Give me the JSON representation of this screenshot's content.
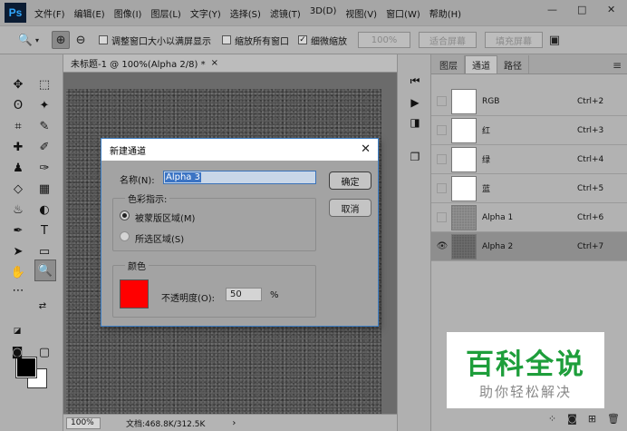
{
  "app": {
    "logo": "Ps"
  },
  "menu": [
    "文件(F)",
    "编辑(E)",
    "图像(I)",
    "图层(L)",
    "文字(Y)",
    "选择(S)",
    "滤镜(T)",
    "3D(D)",
    "视图(V)",
    "窗口(W)",
    "帮助(H)"
  ],
  "window_controls": {
    "minimize": "—",
    "maximize": "□",
    "close": "✕"
  },
  "options": {
    "resize_windows_label": "调整窗口大小以满屏显示",
    "zoom_all_label": "缩放所有窗口",
    "scrubby_zoom_label": "细微缩放",
    "percent_btn": "100%",
    "fit_screen_btn": "适合屏幕",
    "fill_screen_btn": "填充屏幕"
  },
  "document": {
    "tab_title": "未标题-1 @ 100%(Alpha 2/8) *",
    "tab_close": "×",
    "zoom": "100%",
    "doc_info": "文档:468.8K/312.5K"
  },
  "panel": {
    "tabs": [
      "图层",
      "通道",
      "路径"
    ],
    "active_tab": "通道",
    "channels": [
      {
        "name": "RGB",
        "shortcut": "Ctrl+2"
      },
      {
        "name": "红",
        "shortcut": "Ctrl+3"
      },
      {
        "name": "绿",
        "shortcut": "Ctrl+4"
      },
      {
        "name": "蓝",
        "shortcut": "Ctrl+5"
      },
      {
        "name": "Alpha 1",
        "shortcut": "Ctrl+6"
      },
      {
        "name": "Alpha 2",
        "shortcut": "Ctrl+7"
      }
    ]
  },
  "dialog": {
    "title": "新建通道",
    "close": "✕",
    "name_label": "名称(N):",
    "name_value": "Alpha 3",
    "ok_button": "确定",
    "cancel_button": "取消",
    "color_indicates_label": "色彩指示:",
    "masked_areas_label": "被蒙版区域(M)",
    "selected_areas_label": "所选区域(S)",
    "color_group_label": "颜色",
    "opacity_label": "不透明度(O):",
    "opacity_value": "50",
    "opacity_unit": "%",
    "mask_color": "#ff0000"
  },
  "watermark": {
    "title": "百科全说",
    "subtitle": "助你轻松解决"
  }
}
